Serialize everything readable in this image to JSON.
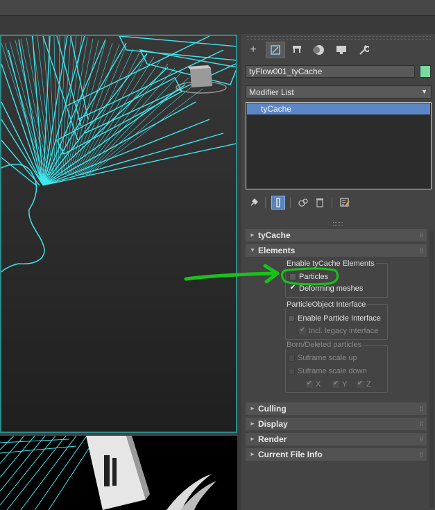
{
  "panel": {
    "tabs": [
      {
        "icon": "plus-icon",
        "glyph": "+"
      },
      {
        "icon": "modify-icon",
        "glyph": "⧉"
      },
      {
        "icon": "hierarchy-icon",
        "glyph": "⊓"
      },
      {
        "icon": "motion-icon",
        "glyph": "●"
      },
      {
        "icon": "display-icon",
        "glyph": "▬"
      },
      {
        "icon": "utilities-icon",
        "glyph": "🔧"
      }
    ],
    "object_name": "tyFlow001_tyCache",
    "object_color": "#7ad9a0",
    "modifier_list_label": "Modifier List",
    "stack_item": "tyCache",
    "rollouts": {
      "tycache": "tyCache",
      "elements": "Elements",
      "culling": "Culling",
      "display": "Display",
      "render": "Render",
      "current_file_info": "Current File Info"
    },
    "groups": {
      "enable_elements": {
        "title": "Enable tyCache Elements",
        "particles": "Particles",
        "deforming_meshes": "Deforming meshes"
      },
      "particle_object": {
        "title": "ParticleObject Interface",
        "enable_particle_interface": "Enable Particle Interface",
        "incl_legacy": "Incl. legacy interface"
      },
      "born_deleted": {
        "title": "Born/Deleted particles",
        "scale_up": "Suframe scale up",
        "scale_down": "Suframe scale down",
        "x": "X",
        "y": "Y",
        "z": "Z"
      }
    }
  },
  "annotation": {
    "color": "#19c219"
  },
  "accent": {
    "viewport_border": "#2d8c8c",
    "wireframe": "#3fe6ee",
    "selection": "#5b87c6"
  }
}
